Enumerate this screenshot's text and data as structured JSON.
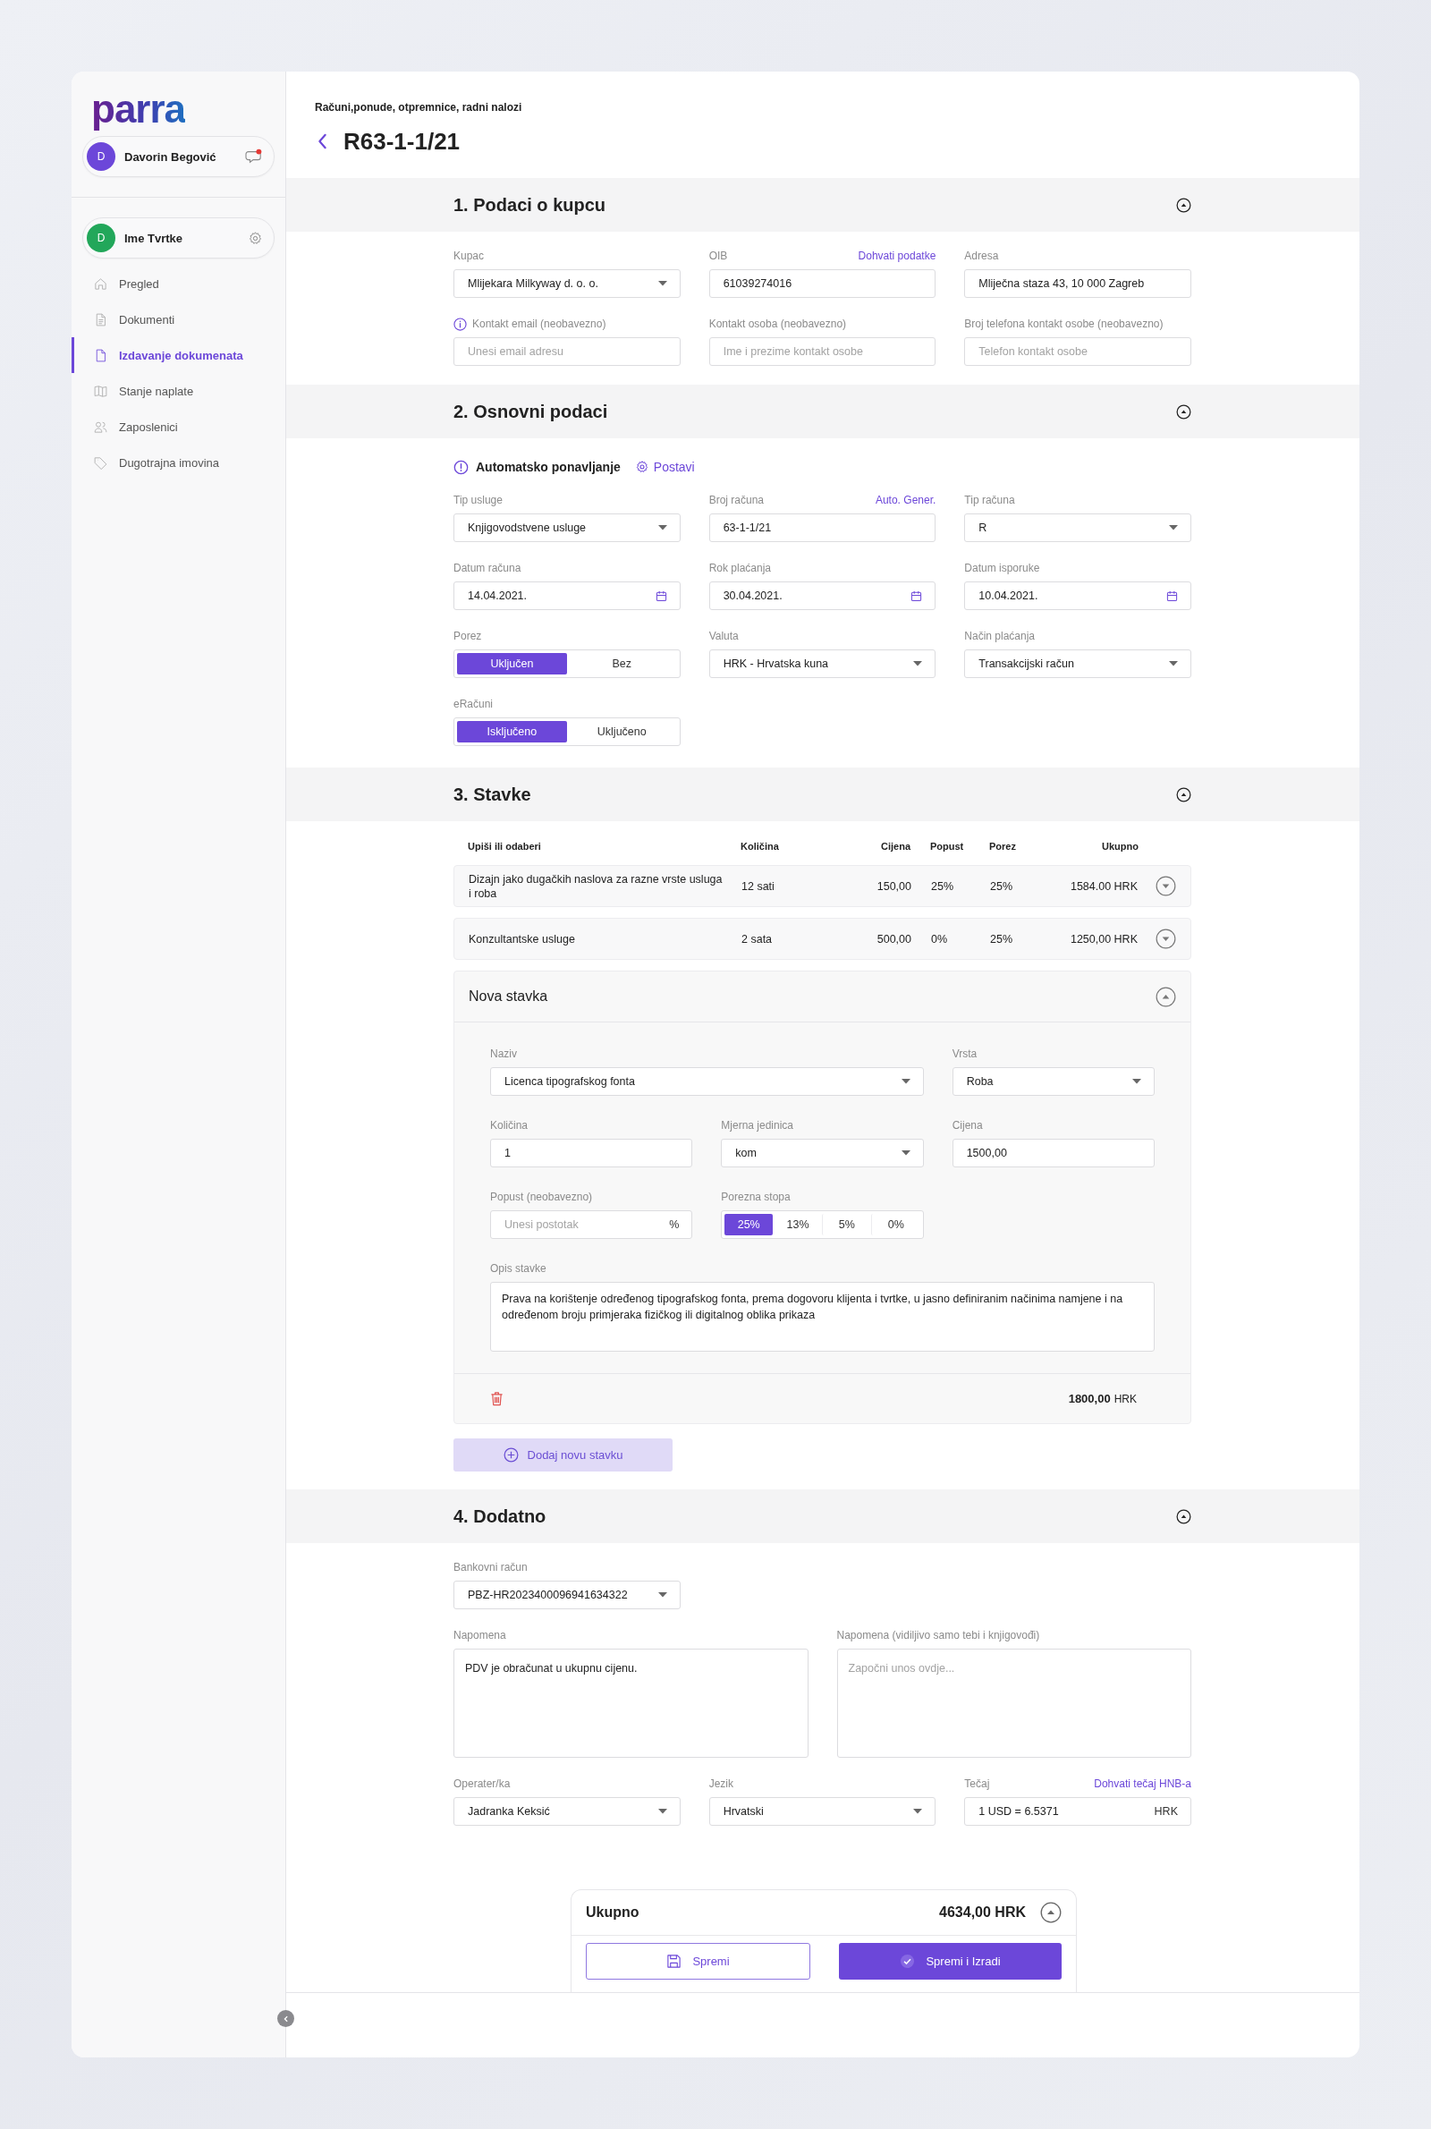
{
  "brand": {
    "logo": "parra"
  },
  "user": {
    "initial": "D",
    "name": "Davorin Begović",
    "has_notification": true
  },
  "company": {
    "initial": "D",
    "name": "Ime Tvrtke"
  },
  "nav": [
    {
      "label": "Pregled",
      "selected": false
    },
    {
      "label": "Dokumenti",
      "selected": false
    },
    {
      "label": "Izdavanje dokumenata",
      "selected": true
    },
    {
      "label": "Stanje naplate",
      "selected": false
    },
    {
      "label": "Zaposlenici",
      "selected": false
    },
    {
      "label": "Dugotrajna imovina",
      "selected": false
    }
  ],
  "breadcrumb": "Računi,ponude, otpremnice, radni nalozi",
  "title": "R63-1-1/21",
  "sections": [
    {
      "kind": "form",
      "title": "1. Podaci o kupcu",
      "expanded": true,
      "rows": [
        [
          {
            "kind": "select",
            "label": "Kupac",
            "value": "Mlijekara Milkyway d. o. o."
          },
          {
            "kind": "text",
            "label": "OIB",
            "link": "Dohvati podatke",
            "value": "61039274016"
          },
          {
            "kind": "text",
            "label": "Adresa",
            "value": "Mliječna staza 43, 10 000 Zagreb"
          }
        ],
        [
          {
            "kind": "text",
            "label": "Kontakt email (neobavezno)",
            "info": true,
            "placeholder": "Unesi email adresu"
          },
          {
            "kind": "text",
            "label": "Kontakt osoba (neobavezno)",
            "placeholder": "Ime i prezime kontakt osobe"
          },
          {
            "kind": "text",
            "label": "Broj telefona kontakt osobe (neobavezno)",
            "placeholder": "Telefon kontakt osobe"
          }
        ]
      ]
    },
    {
      "kind": "form",
      "title": "2. Osnovni podaci",
      "expanded": true,
      "auto_repeat": {
        "label": "Automatsko ponavljanje",
        "action": "Postavi"
      },
      "rows": [
        [
          {
            "kind": "select",
            "label": "Tip usluge",
            "value": "Knjigovodstvene usluge"
          },
          {
            "kind": "text",
            "label": "Broj računa",
            "link": "Auto. Gener.",
            "value": "63-1-1/21"
          },
          {
            "kind": "select",
            "label": "Tip računa",
            "value": "R"
          }
        ],
        [
          {
            "kind": "date",
            "label": "Datum računa",
            "value": "14.04.2021."
          },
          {
            "kind": "date",
            "label": "Rok plaćanja",
            "value": "30.04.2021."
          },
          {
            "kind": "date",
            "label": "Datum isporuke",
            "value": "10.04.2021."
          }
        ],
        [
          {
            "kind": "toggle",
            "label": "Porez",
            "options": [
              {
                "label": "Uključen",
                "selected": true
              },
              {
                "label": "Bez",
                "selected": false
              }
            ]
          },
          {
            "kind": "select",
            "label": "Valuta",
            "value": "HRK - Hrvatska kuna"
          },
          {
            "kind": "select",
            "label": "Način plaćanja",
            "value": "Transakcijski račun"
          }
        ],
        [
          {
            "kind": "toggle",
            "label": "eRačuni",
            "options": [
              {
                "label": "Isključeno",
                "selected": true
              },
              {
                "label": "Uključeno",
                "selected": false
              }
            ]
          }
        ]
      ]
    },
    {
      "kind": "items",
      "title": "3. Stavke",
      "expanded": true,
      "columns": [
        "Upiši ili odaberi",
        "Količina",
        "Cijena",
        "Popust",
        "Porez",
        "Ukupno"
      ],
      "items": [
        {
          "name": "Dizajn jako dugačkih naslova za razne vrste usluga i roba",
          "quantity": "12 sati",
          "price": "150,00",
          "discount": "25%",
          "tax": "25%",
          "total": "1584.00 HRK",
          "expanded": false
        },
        {
          "name": "Konzultantske usluge",
          "quantity": "2 sata",
          "price": "500,00",
          "discount": "0%",
          "tax": "25%",
          "total": "1250,00 HRK",
          "expanded": false
        }
      ],
      "new_item": {
        "title": "Nova stavka",
        "expanded": true,
        "rows": [
          [
            {
              "kind": "select",
              "label": "Naziv",
              "value": "Licenca tipografskog fonta"
            },
            "",
            {
              "kind": "select",
              "label": "Vrsta",
              "value": "Roba"
            }
          ],
          [
            {
              "kind": "text",
              "label": "Količina",
              "value": "1"
            },
            {
              "kind": "select",
              "label": "Mjerna jedinica",
              "value": "kom"
            },
            {
              "kind": "text",
              "label": "Cijena",
              "value": "1500,00"
            }
          ],
          [
            {
              "kind": "text",
              "label": "Popust (neobavezno)",
              "placeholder": "Unesi postotak",
              "suffix": "%"
            },
            {
              "kind": "toggle",
              "label": "Porezna stopa",
              "options": [
                {
                  "label": "25%",
                  "selected": true
                },
                {
                  "label": "13%",
                  "selected": false
                },
                {
                  "label": "5%",
                  "selected": false
                },
                {
                  "label": "0%",
                  "selected": false
                }
              ]
            }
          ],
          [
            {
              "kind": "textarea",
              "label": "Opis stavke",
              "value": "Prava na korištenje određenog tipografskog fonta, prema dogovoru klijenta i tvrtke, u jasno definiranim načinima namjene i na određenom broju primjeraka fizičkog ili digitalnog oblika prikaza"
            }
          ]
        ],
        "total": "1800,00",
        "currency": "HRK"
      },
      "add_button": "Dodaj novu stavku"
    },
    {
      "kind": "form",
      "title": "4. Dodatno",
      "expanded": true,
      "rows": [
        [
          {
            "kind": "select",
            "label": "Bankovni račun",
            "value": "PBZ-HR2023400096941634322"
          }
        ],
        [
          {
            "kind": "textarea",
            "label": "Napomena",
            "value": "PDV je obračunat u ukupnu cijenu."
          },
          {
            "kind": "textarea",
            "label": "Napomena (vidiljivo samo tebi i knjigovođi)",
            "placeholder": "Započni unos ovdje..."
          }
        ],
        [
          {
            "kind": "select",
            "label": "Operater/ka",
            "value": "Jadranka Keksić"
          },
          {
            "kind": "select",
            "label": "Jezik",
            "value": "Hrvatski"
          },
          {
            "kind": "text",
            "label": "Tečaj",
            "link": "Dohvati tečaj HNB-a",
            "value": "1 USD =  6.5371",
            "suffix": "HRK"
          }
        ]
      ]
    }
  ],
  "summary": {
    "label": "Ukupno",
    "amount": "4634,00 HRK",
    "expanded": true,
    "buttons": [
      {
        "kind": "outline",
        "label": "Spremi"
      },
      {
        "kind": "primary",
        "label": "Spremi i Izradi"
      }
    ]
  }
}
